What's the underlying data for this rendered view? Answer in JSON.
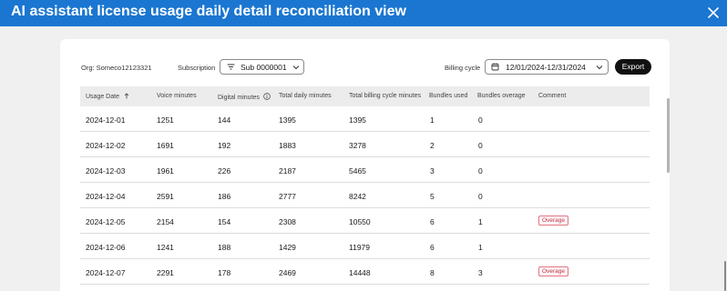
{
  "header": {
    "title": "AI assistant license usage daily detail reconciliation view"
  },
  "filters": {
    "org_label": "Org: Someco12123321",
    "subscription_label": "Subscription",
    "subscription_value": "Sub 0000001",
    "billing_cycle_label": "Billing cycle",
    "billing_cycle_value": "12/01/2024-12/31/2024",
    "export_label": "Export"
  },
  "table": {
    "columns": [
      "Usage Date",
      "Voice minutes",
      "Digital minutes",
      "Total daily minutes",
      "Total billing cycle minutes",
      "Bundles used",
      "Bundles overage",
      "Comment"
    ],
    "rows": [
      [
        "2024-12-01",
        "1251",
        "144",
        "1395",
        "1395",
        "1",
        "0",
        ""
      ],
      [
        "2024-12-02",
        "1691",
        "192",
        "1883",
        "3278",
        "2",
        "0",
        ""
      ],
      [
        "2024-12-03",
        "1961",
        "226",
        "2187",
        "5465",
        "3",
        "0",
        ""
      ],
      [
        "2024-12-04",
        "2591",
        "186",
        "2777",
        "8242",
        "5",
        "0",
        ""
      ],
      [
        "2024-12-05",
        "2154",
        "154",
        "2308",
        "10550",
        "6",
        "1",
        "Overage"
      ],
      [
        "2024-12-06",
        "1241",
        "188",
        "1429",
        "11979",
        "6",
        "1",
        ""
      ],
      [
        "2024-12-07",
        "2291",
        "178",
        "2469",
        "14448",
        "8",
        "3",
        "Overage"
      ]
    ]
  },
  "colors": {
    "header_bg": "#1a76d1",
    "overage_border": "#e27583",
    "overage_text": "#c0354a"
  },
  "icons": [
    "close-icon",
    "filter-icon",
    "chevron-down-icon",
    "calendar-icon",
    "sort-ascending-icon",
    "info-icon"
  ]
}
